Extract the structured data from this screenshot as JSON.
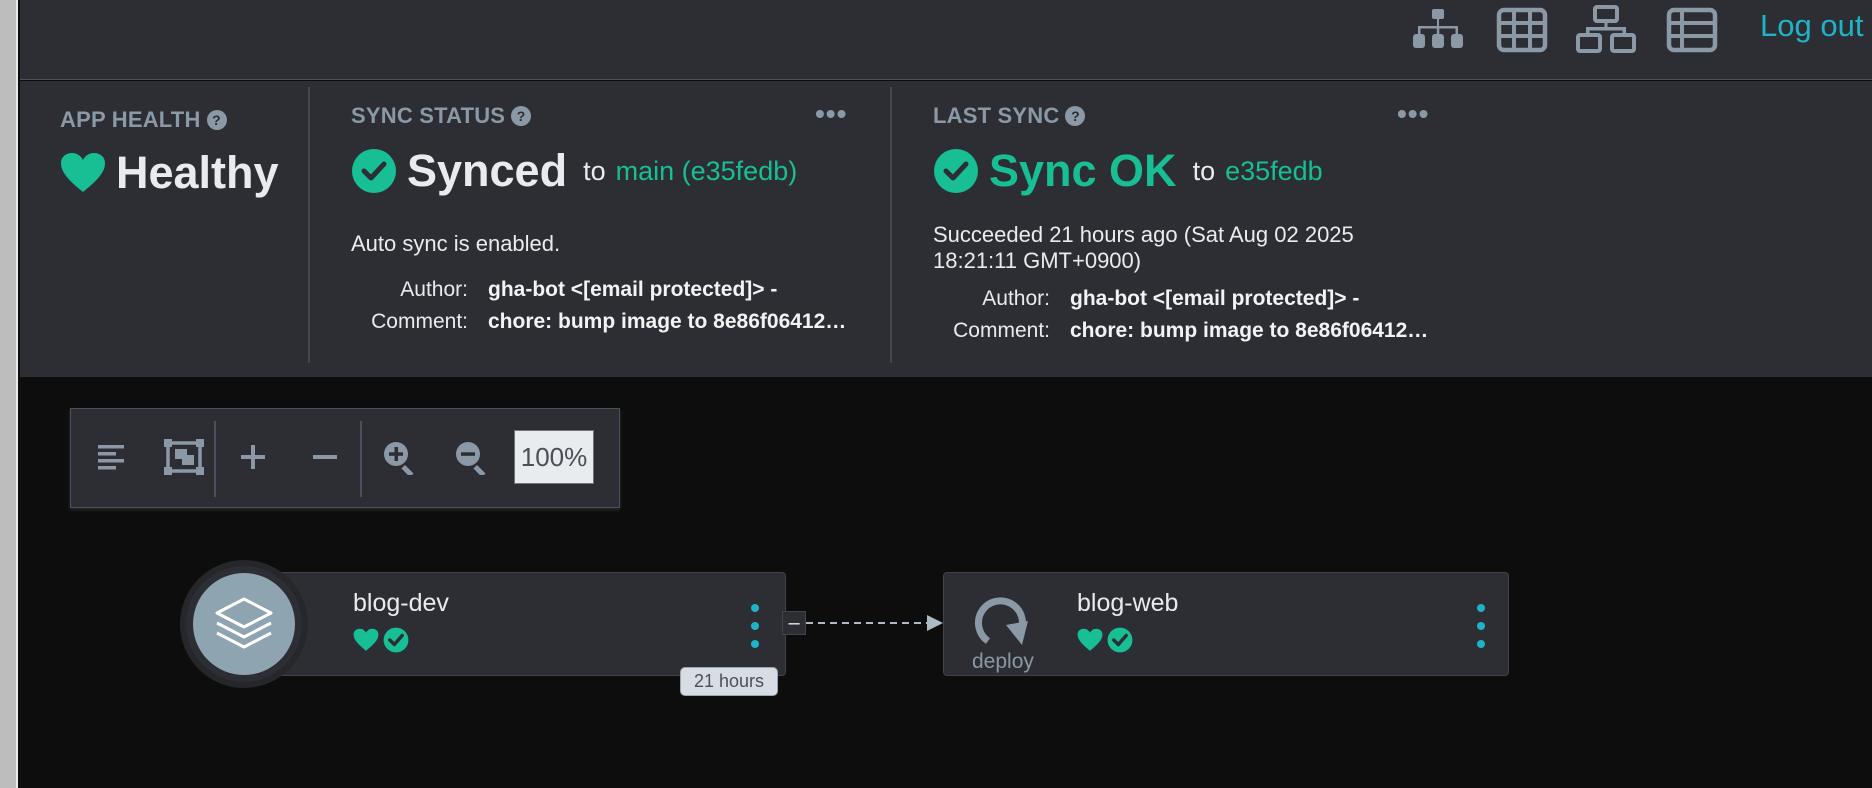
{
  "topbar": {
    "icons": [
      "tree-view-icon",
      "pods-view-icon",
      "network-view-icon",
      "list-view-icon"
    ],
    "logout_label": "Log out"
  },
  "app_health": {
    "title": "APP HEALTH",
    "status": "Healthy"
  },
  "sync_status": {
    "title": "SYNC STATUS",
    "status": "Synced",
    "to_label": "to",
    "revision": "main (e35fedb)",
    "auto_sync_text": "Auto sync is enabled.",
    "author_label": "Author:",
    "author_value": "gha-bot <[email protected]> -",
    "comment_label": "Comment:",
    "comment_value": "chore: bump image to 8e86f06412…"
  },
  "last_sync": {
    "title": "LAST SYNC",
    "status": "Sync OK",
    "to_label": "to",
    "revision": "e35fedb",
    "succeeded_line1": "Succeeded 21 hours ago (Sat Aug 02 2025",
    "succeeded_line2": "18:21:11 GMT+0900)",
    "author_label": "Author:",
    "author_value": "gha-bot <[email protected]> -",
    "comment_label": "Comment:",
    "comment_value": "chore: bump image to 8e86f06412…"
  },
  "graph_toolbar": {
    "zoom_value": "100%"
  },
  "graph": {
    "app_node": {
      "name": "blog-dev",
      "age": "21 hours"
    },
    "deploy_node": {
      "name": "blog-web",
      "kind": "deploy"
    },
    "colors": {
      "healthy": "#18be94",
      "accent": "#1fb3c8",
      "panel": "#2c2e33"
    }
  }
}
